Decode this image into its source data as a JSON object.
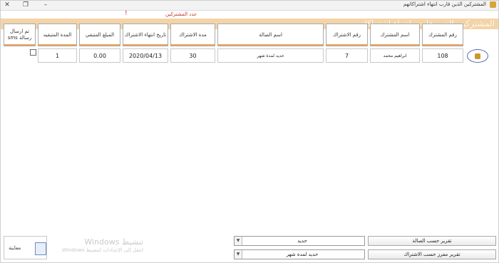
{
  "window": {
    "title": "المشتركين الذين قارب انتهاء اشتراكاتهم",
    "close_label": "✕",
    "restore_label": "❐",
    "minimize_label": "–"
  },
  "header": {
    "count_label": "عدد المشتركين",
    "count_marker": "!",
    "banner": "المشتركين الذين قارب انتهاء اشتراكاتهم"
  },
  "table": {
    "columns": [
      "رقم المشترك",
      "اسم المشترك",
      "رقم الاشتراك",
      "اسم الصالة",
      "مدة الاشتراك",
      "تاريخ انتهاء الاشتراك",
      "المبلغ المتبقي",
      "المدة المتبقيه",
      "تم ارسال رسالة sms"
    ],
    "rows": [
      {
        "member_no": "108",
        "member_name": "ابراهيم محمد",
        "subscription_no": "7",
        "hall_name": "حديد لمدة شهر",
        "duration": "30",
        "end_date": "2020/04/13",
        "remaining_amount": "0.00",
        "remaining_period": "1",
        "sms_sent": false
      }
    ]
  },
  "footer": {
    "print_label": "معاينة",
    "watermark_line1": "تنشيط Windows",
    "watermark_line2": "انتقل إلى الإعدادات لتنشيط Windows.",
    "hall_report_button": "تقرير حسب الصالة",
    "subscription_report_button": "تقرير مفرز حسب الاشتراك",
    "hall_combo_value": "حديد",
    "subscription_combo_value": "حديد لمدة شهر",
    "combo_arrow": "▼"
  },
  "colors": {
    "banner_bg": "#f3d4a8",
    "header_accent": "#f0a35a",
    "count_label_color": "#c0392b"
  }
}
